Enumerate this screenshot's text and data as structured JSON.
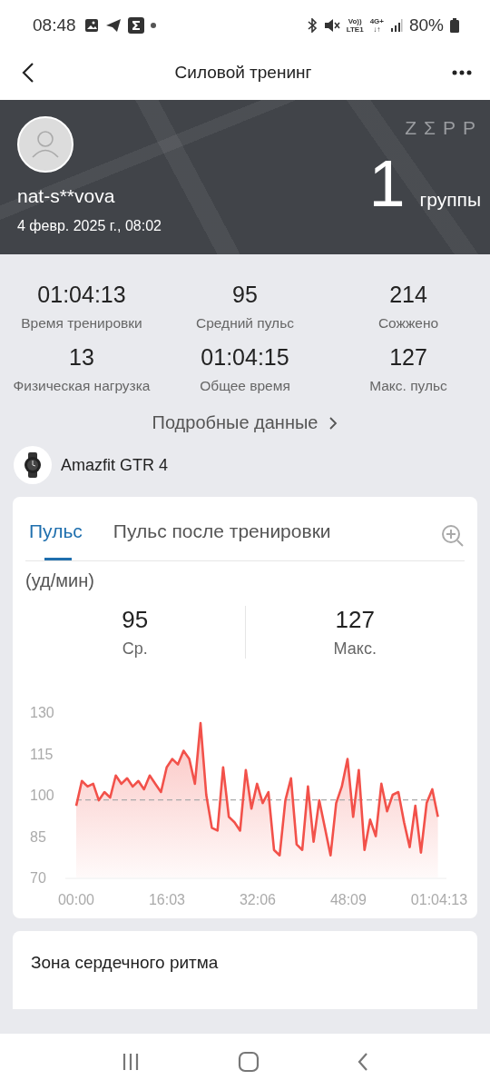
{
  "status_bar": {
    "time": "08:48",
    "network_labels": [
      "Vo))",
      "LTE1",
      "4G+",
      "↓↑"
    ],
    "battery": "80%"
  },
  "header": {
    "title": "Силовой тренинг"
  },
  "banner": {
    "user": "nat-s**vova",
    "date": "4 февр. 2025 г., 08:02",
    "logo": "ZΣPP",
    "count": "1",
    "count_unit": "группы"
  },
  "stats": [
    {
      "value": "01:04:13",
      "label": "Время тренировки"
    },
    {
      "value": "95",
      "label": "Средний пульс"
    },
    {
      "value": "214",
      "label": "Сожжено"
    },
    {
      "value": "13",
      "label": "Физическая нагрузка"
    },
    {
      "value": "01:04:15",
      "label": "Общее время"
    },
    {
      "value": "127",
      "label": "Макс. пульс"
    }
  ],
  "details_link": "Подробные данные",
  "device": {
    "name": "Amazfit GTR 4"
  },
  "heart_card": {
    "tabs": [
      {
        "label": "Пульс",
        "selected": true
      },
      {
        "label": "Пульс после тренировки",
        "selected": false
      }
    ],
    "unit": "(уд/мин)",
    "summary": [
      {
        "value": "95",
        "label": "Ср."
      },
      {
        "value": "127",
        "label": "Макс."
      }
    ],
    "chart_data": {
      "type": "area",
      "x": [
        0,
        1,
        2,
        3,
        4,
        5,
        6,
        7,
        8,
        9,
        10,
        11,
        12,
        13,
        14,
        15,
        16,
        17,
        18,
        19,
        20,
        21,
        22,
        23,
        24,
        25,
        26,
        27,
        28,
        29,
        30,
        31,
        32,
        33,
        34,
        35,
        36,
        37,
        38,
        39,
        40,
        41,
        42,
        43,
        44,
        45,
        46,
        47,
        48,
        49,
        50,
        51,
        52,
        53,
        54,
        55,
        56,
        57,
        58,
        59,
        60,
        61,
        62,
        63,
        64
      ],
      "series": [
        {
          "color": "#f2514a",
          "values": [
            96,
            105,
            103,
            104,
            98,
            101,
            99,
            107,
            104,
            106,
            103,
            105,
            102,
            107,
            104,
            101,
            110,
            113,
            111,
            116,
            113,
            104,
            126,
            100,
            88,
            87,
            110,
            92,
            90,
            87,
            109,
            95,
            104,
            97,
            101,
            80,
            78,
            98,
            106,
            82,
            80,
            103,
            83,
            98,
            88,
            78,
            97,
            103,
            113,
            92,
            109,
            80,
            91,
            85,
            104,
            94,
            100,
            101,
            90,
            81,
            96,
            79,
            97,
            102,
            92
          ]
        }
      ],
      "xlim": [
        0,
        64.22
      ],
      "ylim": [
        70,
        130
      ],
      "yticks": [
        70,
        85,
        100,
        115,
        130
      ],
      "xticks": [
        {
          "value": 0,
          "label": "00:00"
        },
        {
          "value": 16.05,
          "label": "16:03"
        },
        {
          "value": 32.1,
          "label": "32:06"
        },
        {
          "value": 48.15,
          "label": "48:09"
        },
        {
          "value": 64.22,
          "label": "01:04:13"
        }
      ]
    }
  },
  "zone_card": {
    "title": "Зона сердечного ритма"
  }
}
